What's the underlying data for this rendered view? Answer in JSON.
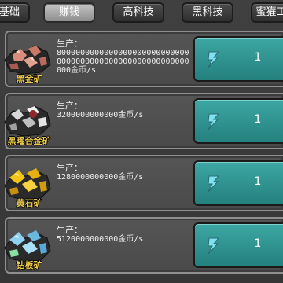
{
  "tabs": [
    {
      "label": "基础",
      "active": false
    },
    {
      "label": "赚钱",
      "active": true
    },
    {
      "label": "高科技",
      "active": false
    },
    {
      "label": "黑科技",
      "active": false
    },
    {
      "label": "蜜獾工",
      "active": false
    }
  ],
  "rows": [
    {
      "ore_name": "黑金矿",
      "production_label": "生产：",
      "production_value": "80000000000000000000000000000000000000000000000000000000000金币/s",
      "upgrade_count": "1",
      "ore_color": "#d8a08f",
      "icon": "lightning-icon"
    },
    {
      "ore_name": "黑曜合金矿",
      "production_label": "生产：",
      "production_value": "3200000000000金币/s",
      "upgrade_count": "1",
      "ore_color": "#e6e6e6",
      "icon": "lightning-icon"
    },
    {
      "ore_name": "黄石矿",
      "production_label": "生产：",
      "production_value": "1280000000000金币/s",
      "upgrade_count": "1",
      "ore_color": "#f0c020",
      "icon": "lightning-icon"
    },
    {
      "ore_name": "钻板矿",
      "production_label": "生产：",
      "production_value": "5120000000000金币/s",
      "upgrade_count": "1",
      "ore_color": "#7ec8e8",
      "icon": "lightning-icon"
    }
  ],
  "colors": {
    "accent_button": "#2f9591",
    "lightning": "#7fe0f0"
  }
}
